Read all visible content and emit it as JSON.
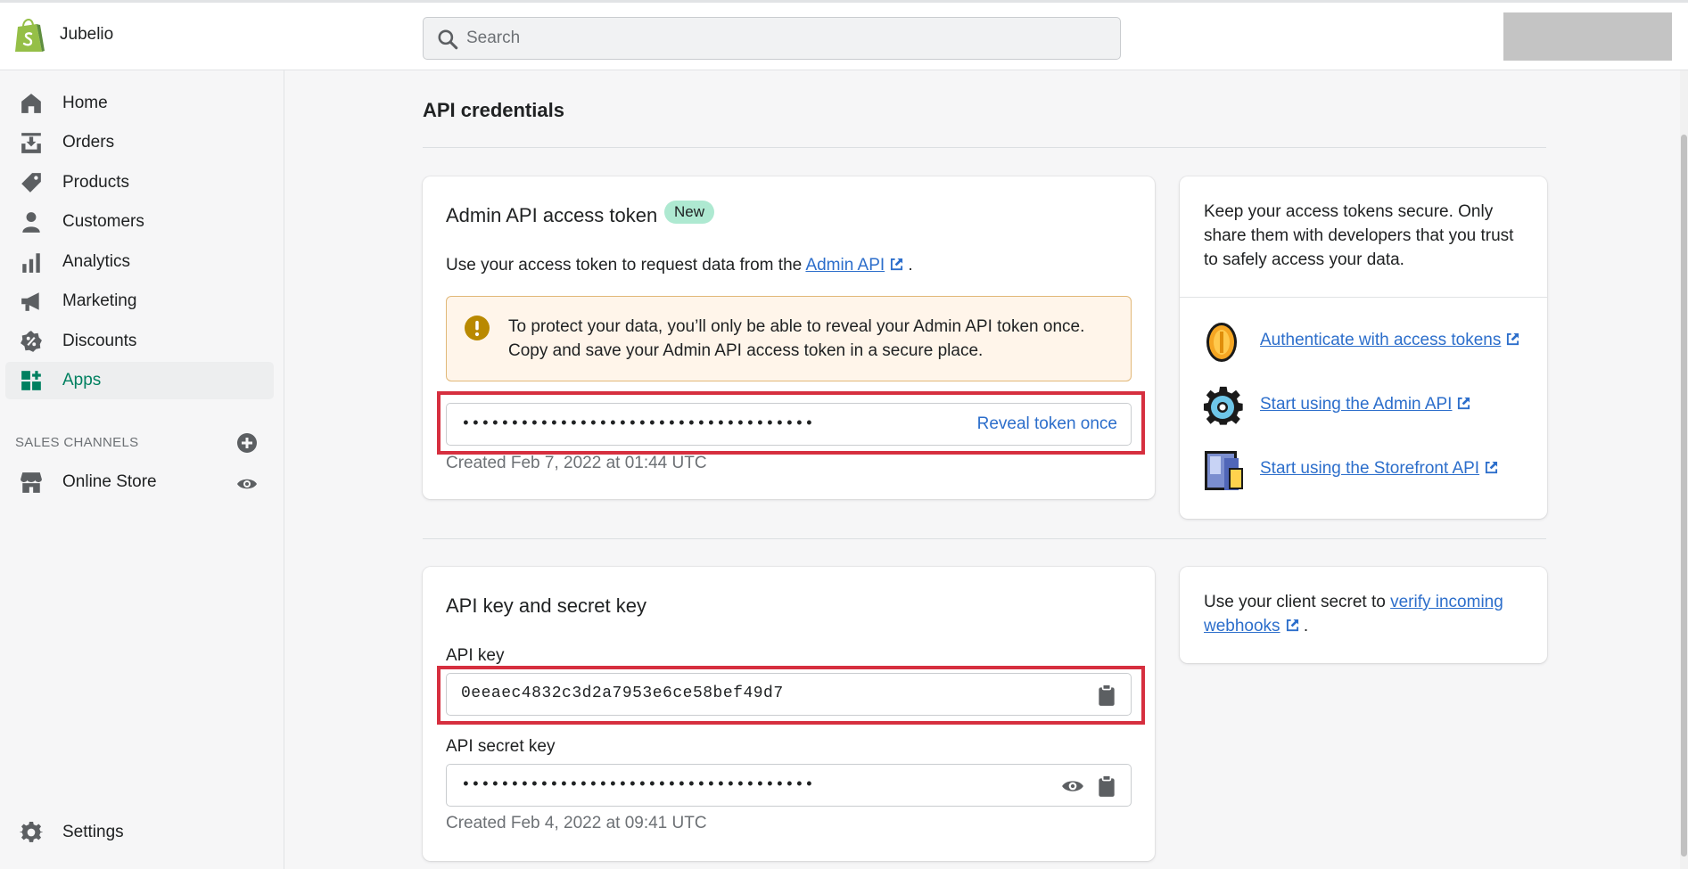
{
  "topbar": {
    "store_name": "Jubelio",
    "search_placeholder": "Search"
  },
  "sidebar": {
    "items": [
      {
        "label": "Home",
        "icon": "home-icon"
      },
      {
        "label": "Orders",
        "icon": "orders-icon"
      },
      {
        "label": "Products",
        "icon": "tag-icon"
      },
      {
        "label": "Customers",
        "icon": "person-icon"
      },
      {
        "label": "Analytics",
        "icon": "bar-chart-icon"
      },
      {
        "label": "Marketing",
        "icon": "megaphone-icon"
      },
      {
        "label": "Discounts",
        "icon": "discount-icon"
      },
      {
        "label": "Apps",
        "icon": "apps-icon",
        "active": true
      }
    ],
    "sales_channels_label": "SALES CHANNELS",
    "online_store_label": "Online Store",
    "settings_label": "Settings"
  },
  "page": {
    "title": "API credentials"
  },
  "admin_token_card": {
    "title": "Admin API access token",
    "badge": "New",
    "description_prefix": "Use your access token to request data from the ",
    "description_link": "Admin API",
    "description_suffix": " .",
    "banner_text": "To protect your data, you’ll only be able to reveal your Admin API token once. Copy and save your Admin API access token in a secure place.",
    "token_masked": "••••••••••••••••••••••••••••••••••••",
    "reveal_label": "Reveal token once",
    "created": "Created Feb 7, 2022 at 01:44 UTC"
  },
  "security_card": {
    "text": "Keep your access tokens secure. Only share them with developers that you trust to safely access your data.",
    "links": [
      {
        "label": "Authenticate with access tokens",
        "icon": "coin-icon"
      },
      {
        "label": "Start using the Admin API",
        "icon": "gear-icon"
      },
      {
        "label": "Start using the Storefront API",
        "icon": "storefront-icon"
      }
    ]
  },
  "api_keys_card": {
    "title": "API key and secret key",
    "api_key_label": "API key",
    "api_key_value": "0eeaec4832c3d2a7953e6ce58bef49d7",
    "secret_label": "API secret key",
    "secret_masked": "••••••••••••••••••••••••••••••••••••",
    "created": "Created Feb 4, 2022 at 09:41 UTC"
  },
  "webhook_card": {
    "prefix": "Use your client secret to ",
    "link": "verify incoming webhooks",
    "suffix": " ."
  },
  "colors": {
    "accent_green": "#008060",
    "link_blue": "#2c6ecb",
    "highlight_red": "#d62f3f",
    "badge_green": "#aee9d1",
    "warning_bg": "#fff5ea"
  }
}
